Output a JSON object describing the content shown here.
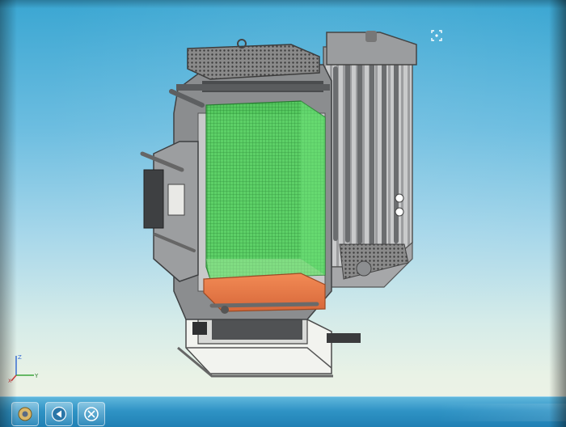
{
  "viewport": {
    "background_top": "#3aa6d2",
    "background_bottom": "#f0f3e6",
    "model": {
      "highlight_green": "#3fd24a",
      "highlight_orange": "#ee7a45",
      "body_gray": "#8b8d8f"
    },
    "fit_view_icon": "fit-view-icon",
    "triad": {
      "axis_z": "Z",
      "axis_y": "Y",
      "axis_x": "X"
    }
  },
  "taskbar": {
    "buttons": [
      {
        "name": "start-app-icon"
      },
      {
        "name": "back-arrow-icon"
      },
      {
        "name": "tool-icon"
      }
    ]
  }
}
